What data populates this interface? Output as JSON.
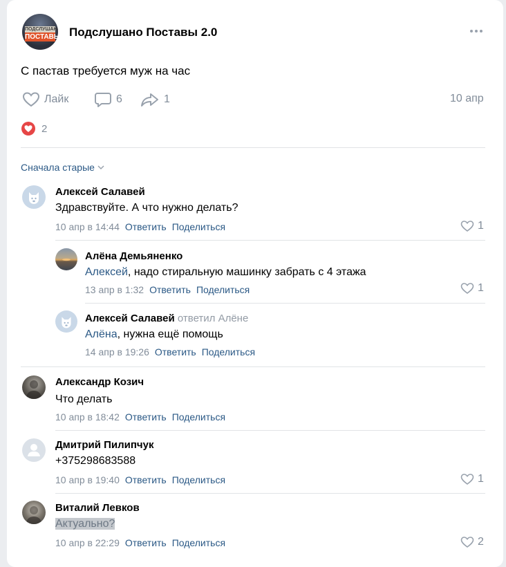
{
  "post": {
    "group_name": "Подслушано Поставы 2.0",
    "avatar_logo_top": "ПОДСЛУШАНО",
    "avatar_logo_bottom": "ПОСТАВЫ",
    "text": "С пастав требуется муж на час",
    "like_label": "Лайк",
    "comments_count": "6",
    "shares_count": "1",
    "date": "10 апр",
    "reactions_count": "2"
  },
  "sort_label": "Сначала старые",
  "colors": {
    "link": "#2a5885",
    "muted": "#818c99",
    "heart": "#e64646"
  },
  "comments": [
    {
      "author": "Алексей Салавей",
      "text": "Здравствуйте. А что нужно делать?",
      "date": "10 апр в 14:44",
      "reply": "Ответить",
      "share": "Поделиться",
      "likes": "1",
      "avatar_icon": "dog-avatar-icon"
    },
    {
      "author": "Алёна Демьяненко",
      "mention": "Алексей",
      "text": ", надо стиральную машинку забрать с 4 этажа",
      "date": "13 апр в 1:32",
      "reply": "Ответить",
      "share": "Поделиться",
      "likes": "1",
      "avatar_icon": "sunset-avatar-icon"
    },
    {
      "author": "Алексей Салавей",
      "replied_to": "ответил Алёне",
      "mention": "Алёна",
      "text": ", нужна ещё помощь",
      "date": "14 апр в 19:26",
      "reply": "Ответить",
      "share": "Поделиться",
      "avatar_icon": "dog-avatar-icon"
    },
    {
      "author": "Александр Козич",
      "text": "Что делать",
      "date": "10 апр в 18:42",
      "reply": "Ответить",
      "share": "Поделиться",
      "avatar_icon": "photo-avatar-icon"
    },
    {
      "author": "Дмитрий Пилипчук",
      "text": "+375298683588",
      "date": "10 апр в 19:40",
      "reply": "Ответить",
      "share": "Поделиться",
      "likes": "1",
      "avatar_icon": "default-avatar-icon"
    },
    {
      "author": "Виталий Левков",
      "text": "Актуально?",
      "date": "10 апр в 22:29",
      "reply": "Ответить",
      "share": "Поделиться",
      "likes": "2",
      "avatar_icon": "photo-avatar-icon"
    }
  ]
}
